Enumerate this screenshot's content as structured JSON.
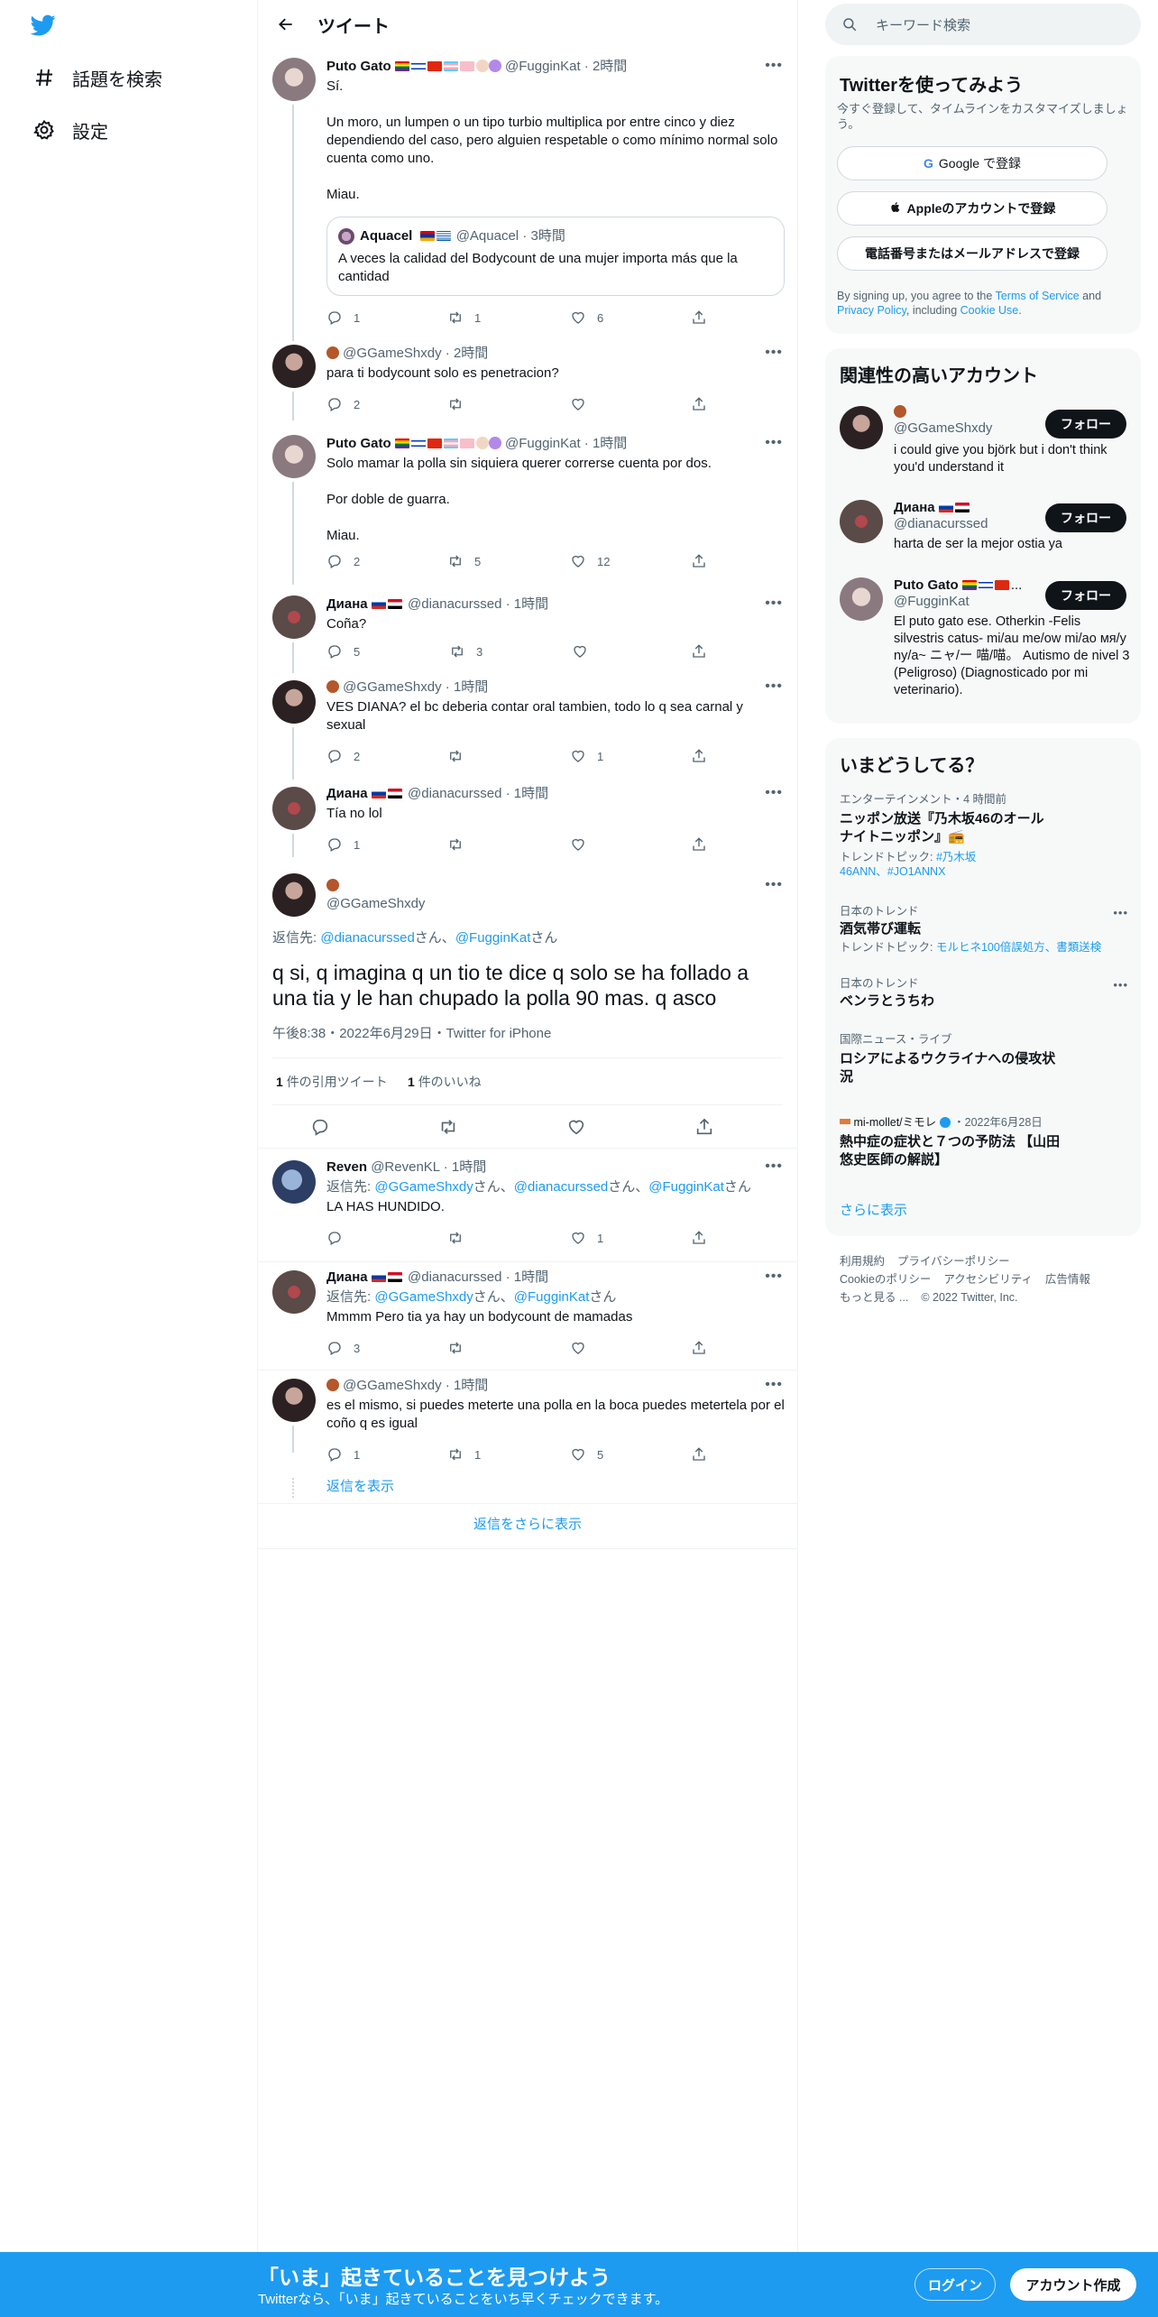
{
  "nav": {
    "explore_label": "話題を検索",
    "settings_label": "設定"
  },
  "header": {
    "title": "ツイート"
  },
  "tweets": [
    {
      "name": "Puto Gato",
      "handle": "@FugginKat",
      "time": "· 2時間",
      "body": "Sí.\n\nUn moro, un lumpen o un tipo turbio multiplica por entre cinco y diez dependiendo del caso, pero alguien respetable o como mínimo normal solo cuenta como uno.\n\nMiau.",
      "quote": {
        "name": "Aquacel",
        "handle": "@Aquacel",
        "time": "· 3時間",
        "body": "A veces la calidad del Bodycount de una mujer importa más que la cantidad"
      },
      "replies": "1",
      "retweets": "1",
      "likes": "6"
    },
    {
      "name": "",
      "handle": "@GGameShxdy",
      "time": "· 2時間",
      "body": "para ti bodycount solo es penetracion?",
      "replies": "2",
      "retweets": "",
      "likes": ""
    },
    {
      "name": "Puto Gato",
      "handle": "@FugginKat",
      "time": "· 1時間",
      "body": "Solo mamar la polla sin siquiera querer correrse cuenta por dos.\n\nPor doble de guarra.\n\nMiau.",
      "replies": "2",
      "retweets": "5",
      "likes": "12"
    },
    {
      "name": "Диана",
      "handle": "@dianacurssed",
      "time": "· 1時間",
      "body": "Coña?",
      "replies": "5",
      "retweets": "3",
      "likes": ""
    },
    {
      "name": "",
      "handle": "@GGameShxdy",
      "time": "· 1時間",
      "body": "VES DIANA? el bc deberia contar oral tambien, todo lo q sea carnal y sexual",
      "replies": "2",
      "retweets": "",
      "likes": "1"
    },
    {
      "name": "Диана",
      "handle": "@dianacurssed",
      "time": "· 1時間",
      "body": "Tía no lol",
      "replies": "1",
      "retweets": "",
      "likes": ""
    }
  ],
  "main_tweet": {
    "handle": "@GGameShxdy",
    "reply_prefix": "返信先: ",
    "reply_to_1": "@dianacurssed",
    "reply_sep": "さん、",
    "reply_to_2": "@FugginKat",
    "reply_suffix": "さん",
    "body": "q si, q imagina q un tio te dice q solo se ha follado a una tia y le han chupado la polla 90 mas. q asco",
    "meta": "午後8:38・2022年6月29日・Twitter for iPhone",
    "quote_count": "1",
    "quote_label": "件の引用ツイート",
    "like_count": "1",
    "like_label": "件のいいね"
  },
  "replies": [
    {
      "name": "Reven",
      "handle": "@RevenKL",
      "time": "· 1時間",
      "reply_prefix": "返信先: ",
      "reply_to": [
        "@GGameShxdy",
        "@dianacurssed",
        "@FugginKat"
      ],
      "body": "LA HAS HUNDIDO.",
      "replies": "",
      "retweets": "",
      "likes": "1"
    },
    {
      "name": "Диана",
      "handle": "@dianacurssed",
      "time": "· 1時間",
      "reply_prefix": "返信先: ",
      "reply_to": [
        "@GGameShxdy",
        "@FugginKat"
      ],
      "body": "Mmmm Pero tia ya hay un bodycount de mamadas",
      "replies": "3",
      "retweets": "",
      "likes": ""
    },
    {
      "name": "",
      "handle": "@GGameShxdy",
      "time": "· 1時間",
      "body": "es el mismo, si puedes meterte una polla en la boca puedes metertela por el coño q es igual",
      "replies": "1",
      "retweets": "1",
      "likes": "5"
    }
  ],
  "show_replies": "返信を表示",
  "show_more_replies": "返信をさらに表示",
  "sidebar": {
    "search_placeholder": "キーワード検索",
    "signup": {
      "title": "Twitterを使ってみよう",
      "subtitle": "今すぐ登録して、タイムラインをカスタマイズしましょう。",
      "google": "Google で登録",
      "apple": "Appleのアカウントで登録",
      "phone": "電話番号またはメールアドレスで登録",
      "terms_1": "By signing up, you agree to the ",
      "terms_link": "Terms of Service",
      "terms_2": " and ",
      "privacy_link": "Privacy Policy",
      "terms_3": ", including ",
      "cookie_link": "Cookie Use",
      "terms_4": "."
    },
    "relevant": {
      "title": "関連性の高いアカウント",
      "follow_label": "フォロー",
      "accounts": [
        {
          "name": "",
          "handle": "@GGameShxdy",
          "bio": "i could give you björk but i don't think you'd understand it"
        },
        {
          "name": "Диана",
          "handle": "@dianacurssed",
          "bio": "harta de ser la mejor ostia ya"
        },
        {
          "name": "Puto Gato",
          "handle": "@FugginKat",
          "bio": "El puto gato ese. Otherkin -Felis silvestris catus- mi/au me/ow mi/ao мя/у ny/a~ ニャ/ー 喵/喵。 Autismo de nivel 3 (Peligroso) (Diagnosticado por mi veterinario)."
        }
      ]
    },
    "trends": {
      "title": "いまどうしてる？",
      "items": [
        {
          "category": "エンターテインメント・4 時間前",
          "title": "ニッポン放送『乃木坂46のオールナイトニッポン』📻",
          "sub_label": "トレンドトピック: ",
          "sub": "#乃木坂46ANN、#JO1ANNX"
        },
        {
          "category": "日本のトレンド",
          "title": "酒気帯び運転",
          "sub_label": "トレンドトピック: ",
          "sub": "モルヒネ100倍誤処方、書類送検"
        },
        {
          "category": "日本のトレンド",
          "title": "ベンラとうちわ",
          "sub_label": "",
          "sub": ""
        },
        {
          "category": "国際ニュース・ライブ",
          "title": "ロシアによるウクライナへの侵攻状況",
          "sub_label": "",
          "sub": ""
        },
        {
          "category_source": "mi-mollet/ミモレ",
          "category_date": "・2022年6月28日",
          "title": "熱中症の症状と７つの予防法 【山田悠史医師の解説】"
        }
      ],
      "show_more": "さらに表示"
    },
    "footer": {
      "links_1": [
        "利用規約",
        "プライバシーポリシー"
      ],
      "links_2": [
        "Cookieのポリシー",
        "アクセシビリティ",
        "広告情報"
      ],
      "more": "もっと見る ...",
      "copyright": "© 2022 Twitter, Inc."
    }
  },
  "bottom_bar": {
    "title": "「いま」起きていることを見つけよう",
    "subtitle": "Twitterなら、「いま」起きていることをいち早くチェックできます。",
    "login": "ログイン",
    "signup": "アカウント作成"
  },
  "colors": {
    "accent": "#1d9bf0",
    "text": "#0f1419",
    "muted": "#536471"
  }
}
